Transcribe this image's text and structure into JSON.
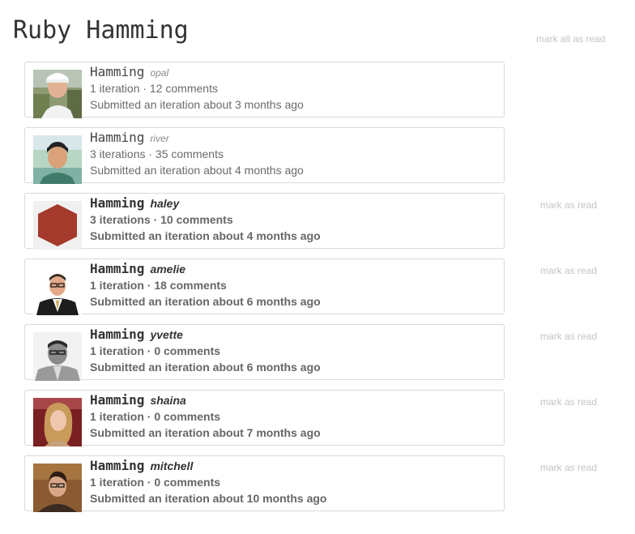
{
  "page": {
    "title": "Ruby Hamming",
    "mark_all_label": "mark all as read"
  },
  "items": [
    {
      "name": "Hamming",
      "track": "opal",
      "meta": "1 iteration · 12 comments",
      "status": "Submitted an iteration about 3 months ago",
      "mark_label": ""
    },
    {
      "name": "Hamming",
      "track": "river",
      "meta": "3 iterations · 35 comments",
      "status": "Submitted an iteration about 4 months ago",
      "mark_label": ""
    },
    {
      "name": "Hamming",
      "track": "haley",
      "meta": "3 iterations · 10 comments",
      "status": "Submitted an iteration about 4 months ago",
      "mark_label": "mark as read"
    },
    {
      "name": "Hamming",
      "track": "amelie",
      "meta": "1 iteration · 18 comments",
      "status": "Submitted an iteration about 6 months ago",
      "mark_label": "mark as read"
    },
    {
      "name": "Hamming",
      "track": "yvette",
      "meta": "1 iteration · 0 comments",
      "status": "Submitted an iteration about 6 months ago",
      "mark_label": "mark as read"
    },
    {
      "name": "Hamming",
      "track": "shaina",
      "meta": "1 iteration · 0 comments",
      "status": "Submitted an iteration about 7 months ago",
      "mark_label": "mark as read"
    },
    {
      "name": "Hamming",
      "track": "mitchell",
      "meta": "1 iteration · 0 comments",
      "status": "Submitted an iteration about 10 months ago",
      "mark_label": "mark as read"
    }
  ],
  "colors": {
    "hexagon": "#a33a2c",
    "mark_link": "#c4c4c4"
  }
}
